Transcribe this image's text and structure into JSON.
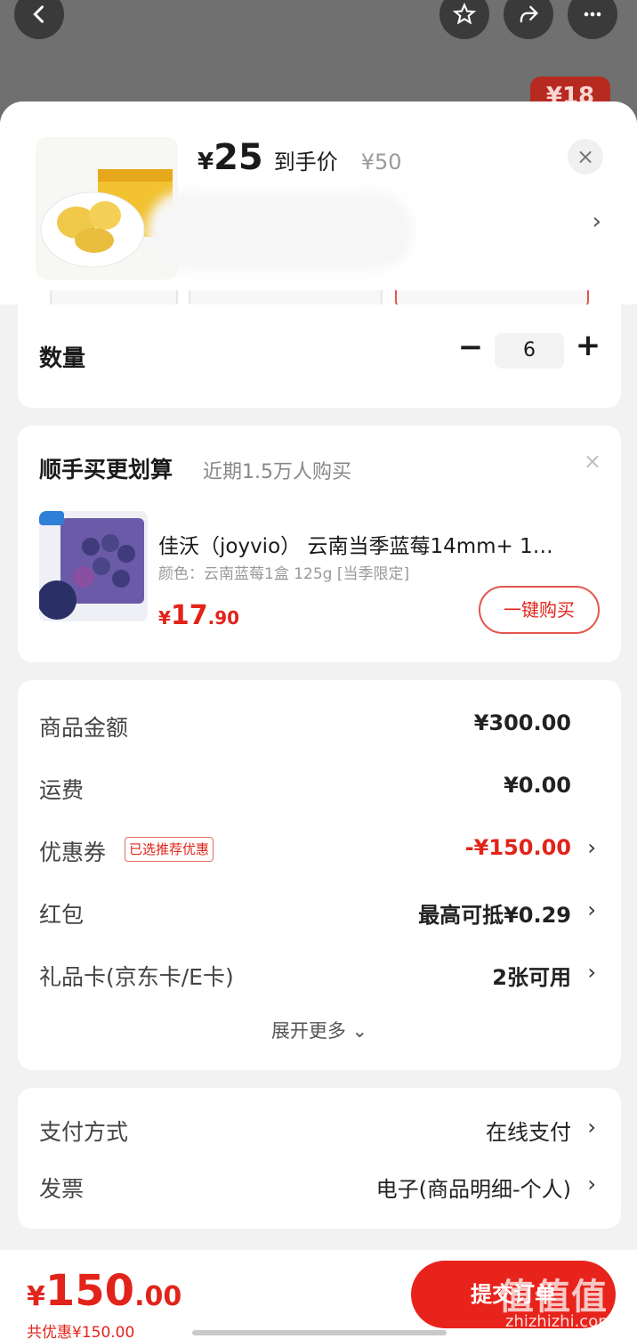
{
  "product": {
    "currency": "¥",
    "price": "25",
    "price_label": "到手价",
    "original_price": "¥50",
    "close": "×",
    "chevron": "›"
  },
  "quantity": {
    "label": "数量",
    "minus": "−",
    "value": "6",
    "plus": "+"
  },
  "recommend": {
    "title": "顺手买更划算",
    "subtitle": "近期1.5万人购买",
    "close": "×",
    "name": "佳沃（joyvio） 云南当季蓝莓14mm+ 1…",
    "spec": "颜色：云南蓝莓1盒 125g [当季限定]",
    "price_yen": "¥",
    "price_int": "17",
    "price_dec": ".90",
    "buy": "一键购买"
  },
  "summary": {
    "rows": [
      {
        "label": "商品金额",
        "value": "¥300.00"
      },
      {
        "label": "运费",
        "value": "¥0.00"
      },
      {
        "label": "优惠券",
        "tag": "已选推荐优惠",
        "value": "-¥150.00",
        "chevron": "›"
      },
      {
        "label": "红包",
        "value": "最高可抵¥0.29",
        "chevron": "›"
      },
      {
        "label": "礼品卡(京东卡/E卡)",
        "value": "2张可用",
        "chevron": "›"
      }
    ],
    "expand": "展开更多 ⌄"
  },
  "payment": {
    "method_label": "支付方式",
    "method_value": "在线支付",
    "invoice_label": "发票",
    "invoice_value": "电子(商品明细-个人)",
    "chevron": "›"
  },
  "footer": {
    "total_yen": "¥",
    "total_int": "150",
    "total_dec": ".00",
    "saved": "共优惠¥150.00",
    "submit": "提交订单",
    "watermark": "值值值",
    "watermark_url": "zhizhizhi.com"
  },
  "topbar": {
    "badge": "¥18"
  },
  "colors": {
    "accent": "#e2231a",
    "sheet_bg": "#f2f2f2",
    "overlay": "#707070"
  }
}
